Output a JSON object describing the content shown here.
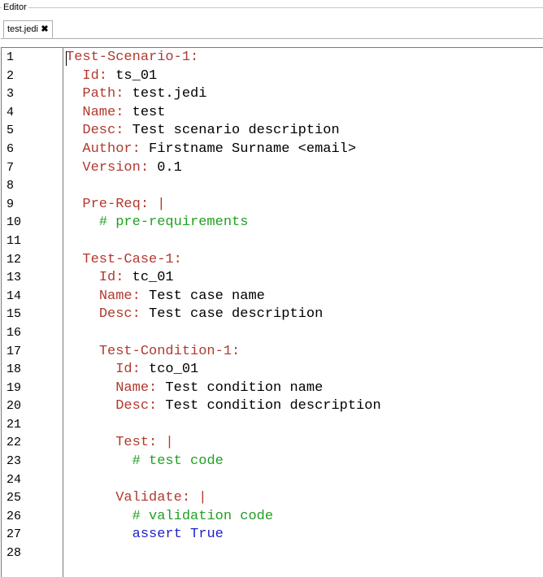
{
  "group": {
    "title": "Editor"
  },
  "tab": {
    "label": "test.jedi",
    "close_icon": "close-icon"
  },
  "colors": {
    "key": "#b03a2e",
    "value": "#000000",
    "comment": "#22a022",
    "keyword": "#1f1fc9"
  },
  "lines": [
    {
      "n": "1",
      "indent": 0,
      "tokens": [
        {
          "t": "key",
          "text": "Test-Scenario-1:"
        }
      ]
    },
    {
      "n": "2",
      "indent": 1,
      "tokens": [
        {
          "t": "key",
          "text": "Id:"
        },
        {
          "t": "val",
          "text": " ts_01"
        }
      ]
    },
    {
      "n": "3",
      "indent": 1,
      "tokens": [
        {
          "t": "key",
          "text": "Path:"
        },
        {
          "t": "val",
          "text": " test.jedi"
        }
      ]
    },
    {
      "n": "4",
      "indent": 1,
      "tokens": [
        {
          "t": "key",
          "text": "Name:"
        },
        {
          "t": "val",
          "text": " test"
        }
      ]
    },
    {
      "n": "5",
      "indent": 1,
      "tokens": [
        {
          "t": "key",
          "text": "Desc:"
        },
        {
          "t": "val",
          "text": " Test scenario description"
        }
      ]
    },
    {
      "n": "6",
      "indent": 1,
      "tokens": [
        {
          "t": "key",
          "text": "Author:"
        },
        {
          "t": "val",
          "text": " Firstname Surname <email>"
        }
      ]
    },
    {
      "n": "7",
      "indent": 1,
      "tokens": [
        {
          "t": "key",
          "text": "Version:"
        },
        {
          "t": "val",
          "text": " 0.1"
        }
      ]
    },
    {
      "n": "8",
      "indent": 0,
      "tokens": []
    },
    {
      "n": "9",
      "indent": 1,
      "tokens": [
        {
          "t": "key",
          "text": "Pre-Req: |"
        }
      ]
    },
    {
      "n": "10",
      "indent": 2,
      "tokens": [
        {
          "t": "comment",
          "text": "# pre-requirements"
        }
      ]
    },
    {
      "n": "11",
      "indent": 0,
      "tokens": []
    },
    {
      "n": "12",
      "indent": 1,
      "tokens": [
        {
          "t": "key",
          "text": "Test-Case-1:"
        }
      ]
    },
    {
      "n": "13",
      "indent": 2,
      "tokens": [
        {
          "t": "key",
          "text": "Id:"
        },
        {
          "t": "val",
          "text": " tc_01"
        }
      ]
    },
    {
      "n": "14",
      "indent": 2,
      "tokens": [
        {
          "t": "key",
          "text": "Name:"
        },
        {
          "t": "val",
          "text": " Test case name"
        }
      ]
    },
    {
      "n": "15",
      "indent": 2,
      "tokens": [
        {
          "t": "key",
          "text": "Desc:"
        },
        {
          "t": "val",
          "text": " Test case description"
        }
      ]
    },
    {
      "n": "16",
      "indent": 0,
      "tokens": []
    },
    {
      "n": "17",
      "indent": 2,
      "tokens": [
        {
          "t": "key",
          "text": "Test-Condition-1:"
        }
      ]
    },
    {
      "n": "18",
      "indent": 3,
      "tokens": [
        {
          "t": "key",
          "text": "Id:"
        },
        {
          "t": "val",
          "text": " tco_01"
        }
      ]
    },
    {
      "n": "19",
      "indent": 3,
      "tokens": [
        {
          "t": "key",
          "text": "Name:"
        },
        {
          "t": "val",
          "text": " Test condition name"
        }
      ]
    },
    {
      "n": "20",
      "indent": 3,
      "tokens": [
        {
          "t": "key",
          "text": "Desc:"
        },
        {
          "t": "val",
          "text": " Test condition description"
        }
      ]
    },
    {
      "n": "21",
      "indent": 0,
      "tokens": []
    },
    {
      "n": "22",
      "indent": 3,
      "tokens": [
        {
          "t": "key",
          "text": "Test: |"
        }
      ]
    },
    {
      "n": "23",
      "indent": 4,
      "tokens": [
        {
          "t": "comment",
          "text": "# test code"
        }
      ]
    },
    {
      "n": "24",
      "indent": 0,
      "tokens": []
    },
    {
      "n": "25",
      "indent": 3,
      "tokens": [
        {
          "t": "key",
          "text": "Validate: |"
        }
      ]
    },
    {
      "n": "26",
      "indent": 4,
      "tokens": [
        {
          "t": "comment",
          "text": "# validation code"
        }
      ]
    },
    {
      "n": "27",
      "indent": 4,
      "tokens": [
        {
          "t": "kw",
          "text": "assert True"
        }
      ]
    },
    {
      "n": "28",
      "indent": 0,
      "tokens": []
    }
  ]
}
